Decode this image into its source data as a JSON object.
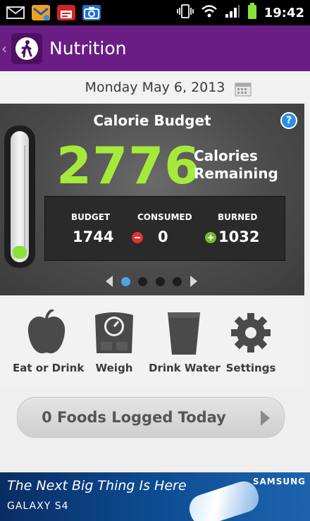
{
  "status_bar": {
    "time": "19:42",
    "left_icons": [
      "email-icon",
      "missed-call-icon",
      "app-notification-icon",
      "camera-icon"
    ],
    "right_icons": [
      "vibrate-icon",
      "wifi-icon",
      "signal-icon",
      "battery-icon"
    ]
  },
  "header": {
    "title": "Nutrition",
    "icon": "walking-person-icon"
  },
  "date": {
    "label": "Monday May 6, 2013"
  },
  "calorie_panel": {
    "title": "Calorie Budget",
    "remaining_value": "2776",
    "remaining_label_line1": "Calories",
    "remaining_label_line2": "Remaining",
    "consumed_fraction": 0.08,
    "stats": {
      "budget_label": "BUDGET",
      "budget_value": "1744",
      "consumed_label": "CONSUMED",
      "consumed_value": "0",
      "burned_label": "BURNED",
      "burned_value": "1032"
    },
    "page_dots": 4,
    "active_page": 1
  },
  "actions": [
    {
      "label": "Eat or Drink",
      "icon": "apple-icon"
    },
    {
      "label": "Weigh",
      "icon": "scale-icon"
    },
    {
      "label": "Drink Water",
      "icon": "water-glass-icon"
    },
    {
      "label": "Settings",
      "icon": "gear-icon"
    }
  ],
  "foods_logged": {
    "label": "0 Foods Logged Today"
  },
  "ad": {
    "tagline": "The Next Big Thing Is Here",
    "product": "GALAXY S4",
    "brand": "SAMSUNG"
  },
  "colors": {
    "header_bg": "#6a1d84",
    "calorie_green": "#a5ea3a",
    "active_dot": "#4aa6e6",
    "help_blue": "#2a8fe6"
  }
}
